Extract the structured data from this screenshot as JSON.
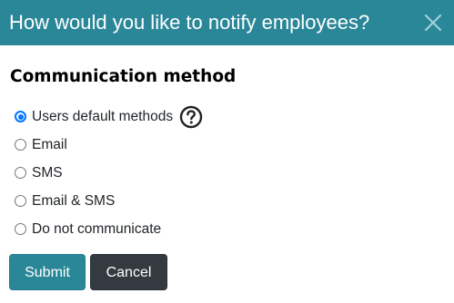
{
  "dialog": {
    "title": "How would you like to notify employees?",
    "close_icon": "close-icon",
    "header_color": "#2a8798"
  },
  "section": {
    "title": "Communication method"
  },
  "options": [
    {
      "label": "Users default methods",
      "selected": true,
      "help_icon": "question-circle-icon"
    },
    {
      "label": "Email",
      "selected": false
    },
    {
      "label": "SMS",
      "selected": false
    },
    {
      "label": "Email & SMS",
      "selected": false
    },
    {
      "label": "Do not communicate",
      "selected": false
    }
  ],
  "buttons": {
    "submit_label": "Submit",
    "submit_color": "#2a8798",
    "cancel_label": "Cancel",
    "cancel_color": "#343a40"
  }
}
